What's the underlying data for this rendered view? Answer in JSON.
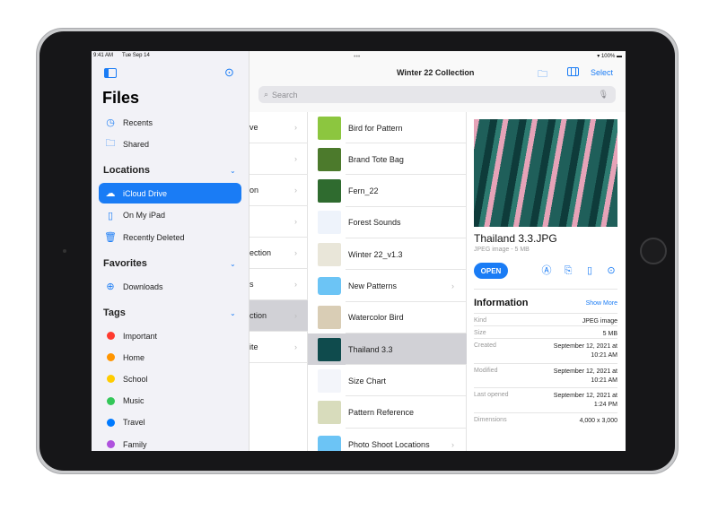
{
  "status": {
    "time": "9:41 AM",
    "date": "Tue Sep 14",
    "battery": "100%"
  },
  "sidebar": {
    "title": "Files",
    "top_items": [
      {
        "label": "Recents",
        "icon": "clock-icon"
      },
      {
        "label": "Shared",
        "icon": "shared-folder-icon"
      }
    ],
    "locations_header": "Locations",
    "locations": [
      {
        "label": "iCloud Drive",
        "icon": "cloud-icon",
        "selected": true
      },
      {
        "label": "On My iPad",
        "icon": "ipad-icon"
      },
      {
        "label": "Recently Deleted",
        "icon": "trash-icon"
      }
    ],
    "favorites_header": "Favorites",
    "favorites": [
      {
        "label": "Downloads",
        "icon": "download-icon"
      }
    ],
    "tags_header": "Tags",
    "tags": [
      {
        "label": "Important",
        "color": "#ff3b30"
      },
      {
        "label": "Home",
        "color": "#ff9500"
      },
      {
        "label": "School",
        "color": "#ffcc00"
      },
      {
        "label": "Music",
        "color": "#34c759"
      },
      {
        "label": "Travel",
        "color": "#007aff"
      },
      {
        "label": "Family",
        "color": "#af52de"
      }
    ]
  },
  "toolbar": {
    "title": "Winter 22 Collection",
    "select_label": "Select",
    "search_placeholder": "Search"
  },
  "column1": [
    "ve",
    "",
    "on",
    "",
    "ection",
    "s",
    "ction",
    "ite"
  ],
  "column1_selected": 6,
  "column2": [
    {
      "label": "Bird for Pattern",
      "thumb": "#8cc63f"
    },
    {
      "label": "Brand Tote Bag",
      "thumb": "#4c7a2c"
    },
    {
      "label": "Fern_22",
      "thumb": "#2f6b2f"
    },
    {
      "label": "Forest Sounds",
      "thumb": "#eef3fb"
    },
    {
      "label": "Winter 22_v1.3",
      "thumb": "#e9e6d9"
    },
    {
      "label": "New Patterns",
      "thumb": "#6cc4f5",
      "folder": true
    },
    {
      "label": "Watercolor Bird",
      "thumb": "#d9cdb5"
    },
    {
      "label": "Thailand 3.3",
      "thumb": "#0f4b4d",
      "selected": true
    },
    {
      "label": "Size Chart",
      "thumb": "#f3f5fa"
    },
    {
      "label": "Pattern Reference",
      "thumb": "#d8dcbc"
    },
    {
      "label": "Photo Shoot Locations",
      "thumb": "#6cc4f5",
      "folder": true
    }
  ],
  "detail": {
    "filename": "Thailand 3.3.JPG",
    "subtitle": "JPEG image - 5 MB",
    "open_label": "OPEN",
    "info_title": "Information",
    "show_more": "Show More",
    "info": [
      {
        "k": "Kind",
        "v": "JPEG image"
      },
      {
        "k": "Size",
        "v": "5 MB"
      },
      {
        "k": "Created",
        "v": "September 12, 2021 at",
        "v2": "10:21 AM"
      },
      {
        "k": "Modified",
        "v": "September 12, 2021 at",
        "v2": "10:21 AM"
      },
      {
        "k": "Last opened",
        "v": "September 12, 2021 at",
        "v2": "1:24 PM"
      },
      {
        "k": "Dimensions",
        "v": "4,000 x 3,000"
      }
    ]
  }
}
